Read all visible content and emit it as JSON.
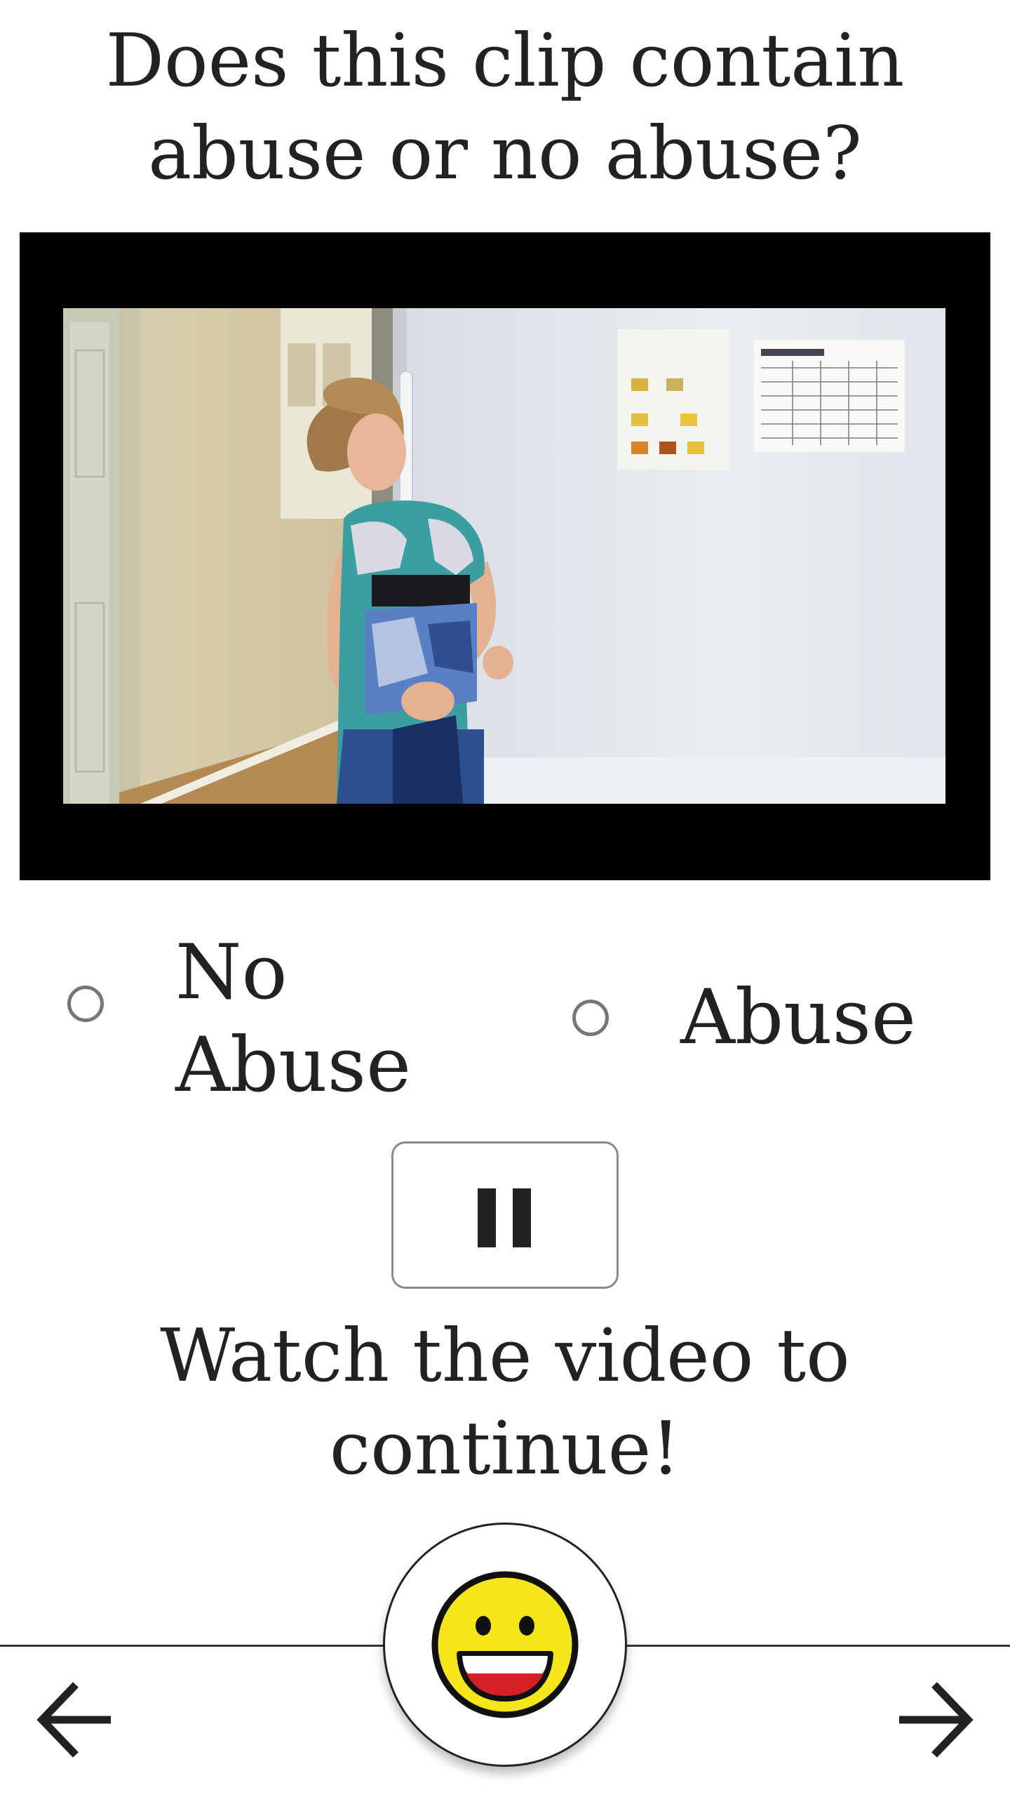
{
  "question": {
    "line1": "Does this clip contain",
    "line2": "abuse or no abuse?"
  },
  "video": {
    "icon": "video-frame"
  },
  "options": [
    {
      "line1": "No",
      "line2": "Abuse",
      "selected": false
    },
    {
      "line1": "Abuse",
      "selected": false
    }
  ],
  "pause_button": {
    "icon": "pause-icon"
  },
  "message": {
    "line1": "Watch the video to",
    "line2": "continue!"
  },
  "emoji": {
    "icon": "grinning-face-icon",
    "color": "#f7e51b"
  },
  "nav": {
    "back_icon": "arrow-left-icon",
    "forward_icon": "arrow-right-icon"
  }
}
